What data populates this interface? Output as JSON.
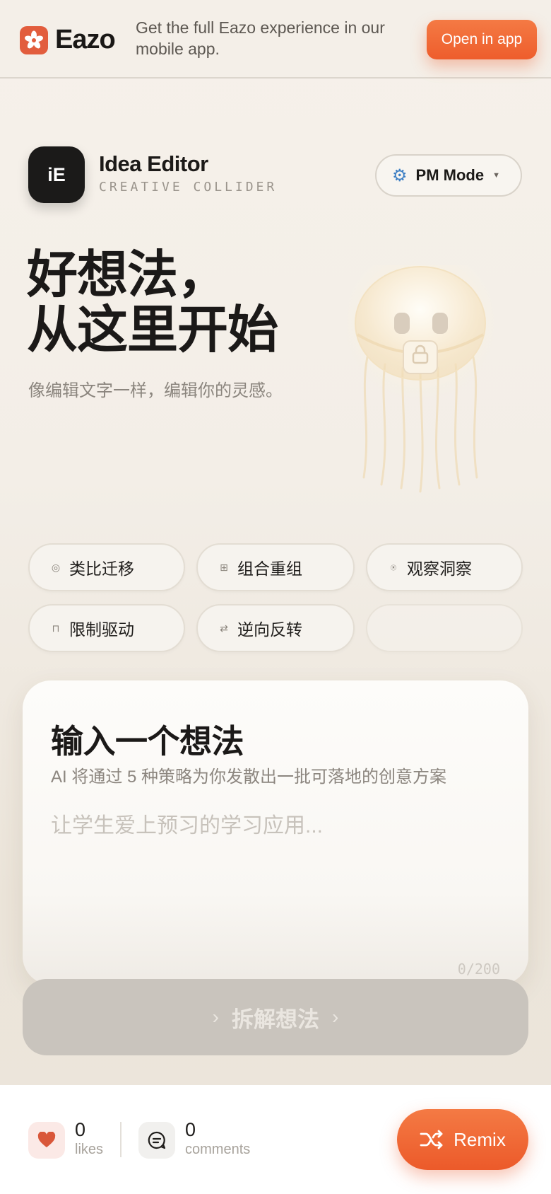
{
  "promo": {
    "brand": "Eazo",
    "message": "Get the full Eazo experience in our mobile app.",
    "open_button": "Open in app"
  },
  "app": {
    "icon_text": "iE",
    "title": "Idea Editor",
    "subtitle": "CREATIVE COLLIDER",
    "mode": "PM Mode",
    "mode_icon": "gear-icon"
  },
  "hero": {
    "line1": "好想法，",
    "line2": "从这里开始",
    "subtitle": "像编辑文字一样，编辑你的灵感。"
  },
  "strategies": [
    {
      "icon": "◎",
      "label": "类比迁移"
    },
    {
      "icon": "⊞",
      "label": "组合重组"
    },
    {
      "icon": "⍟",
      "label": "观察洞察"
    },
    {
      "icon": "⊓",
      "label": "限制驱动"
    },
    {
      "icon": "⇄",
      "label": "逆向反转"
    },
    {
      "icon": "",
      "label": ""
    }
  ],
  "input_card": {
    "title": "输入一个想法",
    "subtitle": "AI 将通过 5 种策略为你发散出一批可落地的创意方案",
    "placeholder": "让学生爱上预习的学习应用...",
    "char_count": "0/200"
  },
  "submit": {
    "label": "拆解想法",
    "chevron": "›"
  },
  "stats": {
    "likes_count": "0",
    "likes_label": "likes",
    "comments_count": "0",
    "comments_label": "comments"
  },
  "remix": {
    "label": "Remix"
  },
  "colors": {
    "accent": "#ee5d2c",
    "brand": "#e25d3d",
    "disabled_button": "#c9c4bd"
  }
}
